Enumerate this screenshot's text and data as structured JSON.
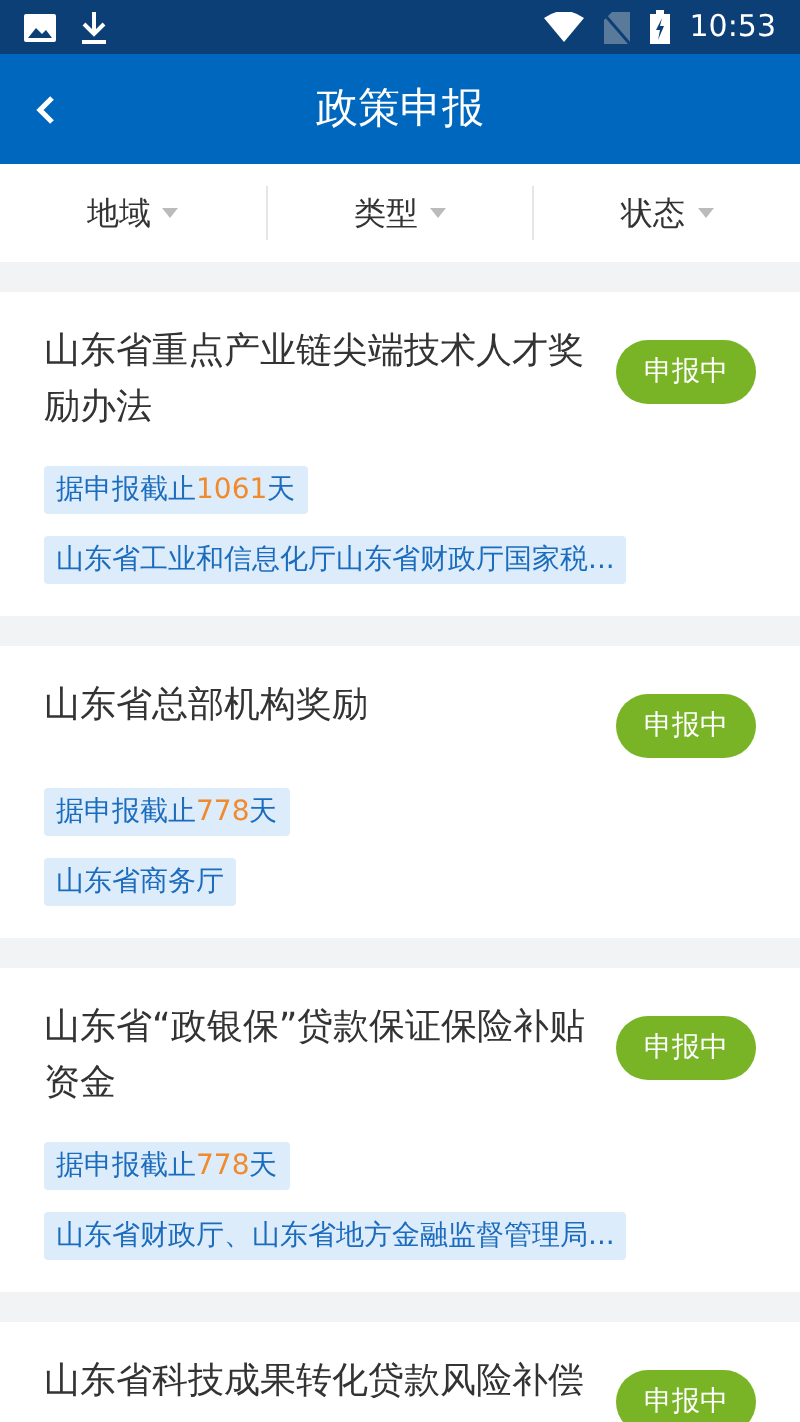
{
  "status_bar": {
    "time": "10:53"
  },
  "header": {
    "title": "政策申报"
  },
  "filters": [
    {
      "label": "地域"
    },
    {
      "label": "类型"
    },
    {
      "label": "状态"
    }
  ],
  "policies": [
    {
      "title": "山东省重点产业链尖端技术人才奖励办法",
      "status": "申报中",
      "deadline_prefix": "据申报截止",
      "deadline_days": "1061",
      "deadline_suffix": "天",
      "department": "山东省工业和信息化厅山东省财政厅国家税..."
    },
    {
      "title": "山东省总部机构奖励",
      "status": "申报中",
      "deadline_prefix": "据申报截止",
      "deadline_days": "778",
      "deadline_suffix": "天",
      "department": "山东省商务厅"
    },
    {
      "title": "山东省“政银保”贷款保证保险补贴资金",
      "status": "申报中",
      "deadline_prefix": "据申报截止",
      "deadline_days": "778",
      "deadline_suffix": "天",
      "department": "山东省财政厅、山东省地方金融监督管理局..."
    },
    {
      "title": "山东省科技成果转化贷款风险补偿",
      "status": "申报中"
    }
  ]
}
